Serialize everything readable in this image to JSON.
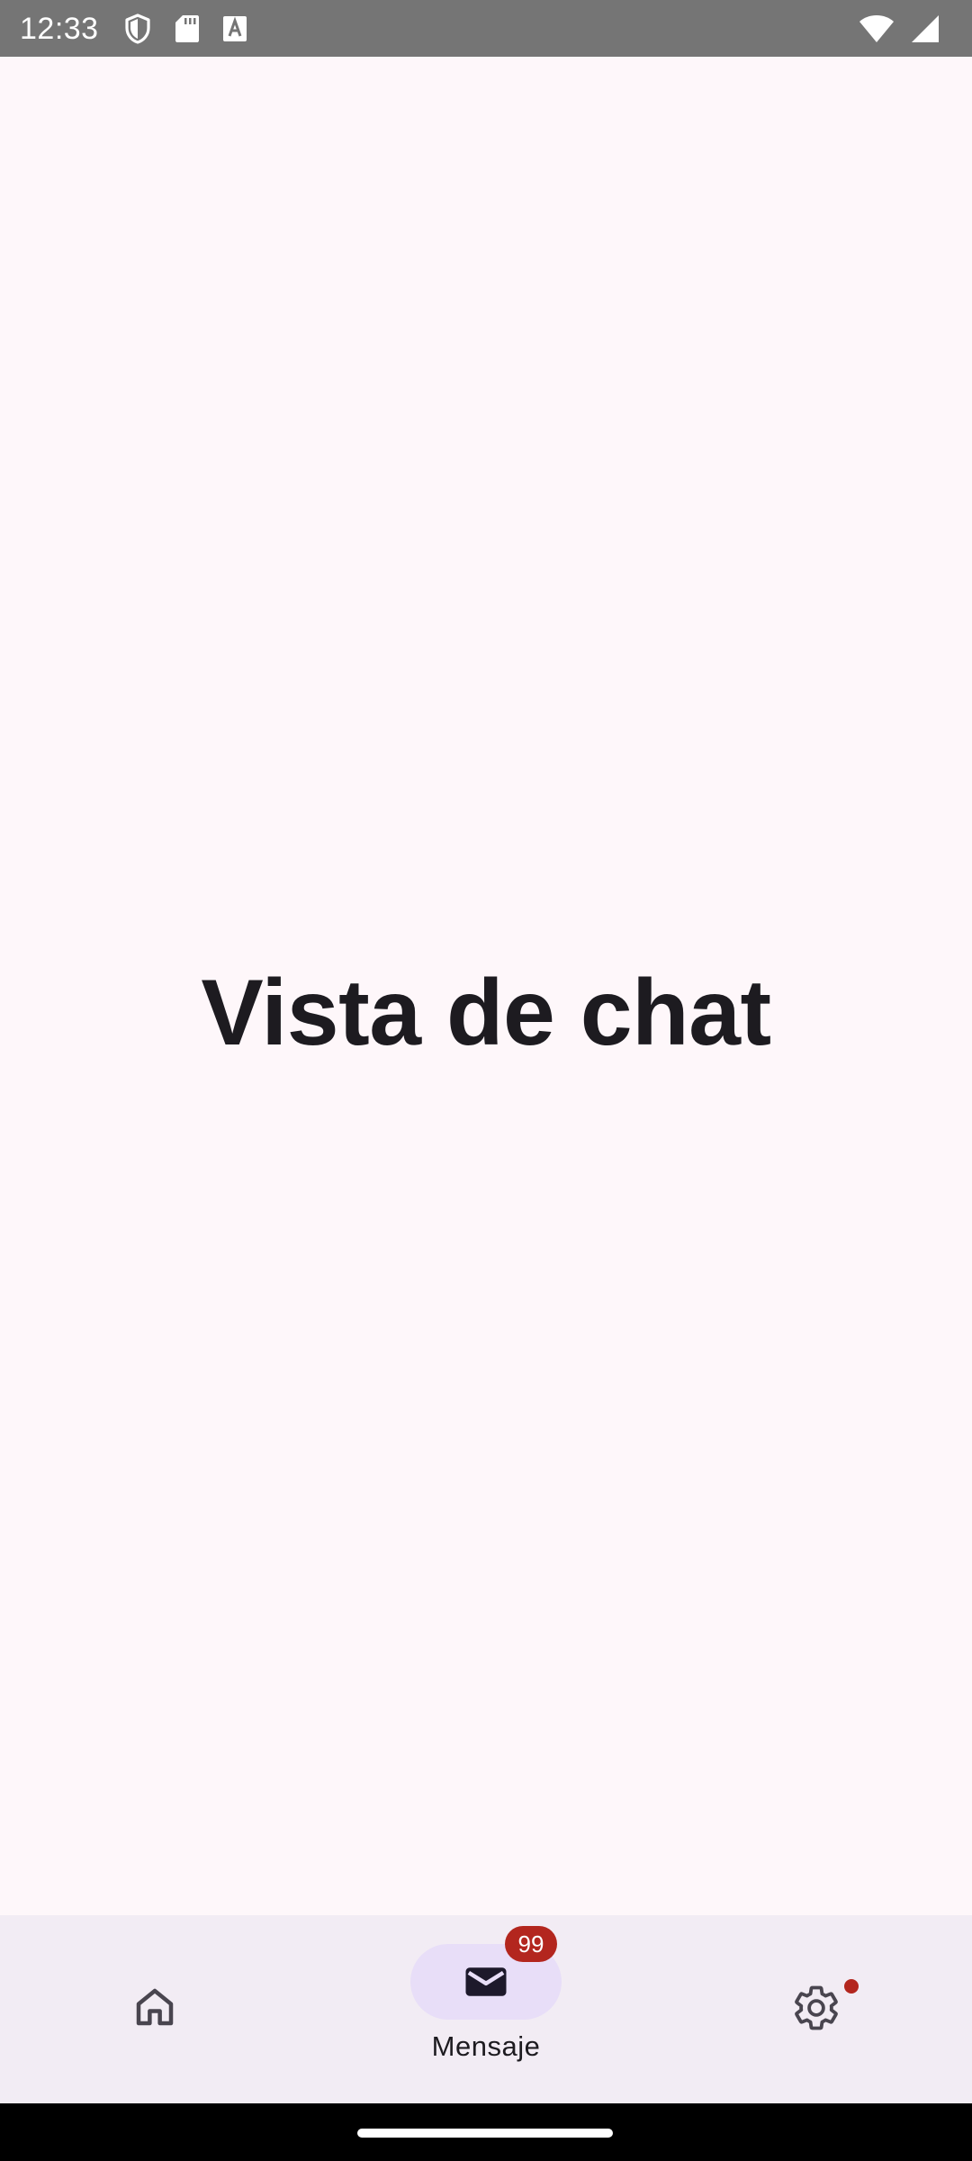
{
  "status_bar": {
    "time": "12:33",
    "left_icons": [
      "shield-icon",
      "sd-card-icon",
      "a-letter-icon"
    ],
    "right_icons": [
      "wifi-icon",
      "cell-signal-icon"
    ],
    "background": "#757575"
  },
  "main": {
    "title": "Vista de chat",
    "background": "#FEF7FA"
  },
  "bottom_nav": {
    "background": "#F2ECF4",
    "items": [
      {
        "icon": "home-icon",
        "label": "",
        "selected": false
      },
      {
        "icon": "mail-icon",
        "label": "Mensaje",
        "selected": true,
        "badge": "99"
      },
      {
        "icon": "gear-icon",
        "label": "",
        "selected": false,
        "dot": true
      }
    ],
    "indicator_color": "#E8DEF8",
    "badge_color": "#B3261E"
  },
  "system_nav": {
    "type": "gesture-bar"
  }
}
